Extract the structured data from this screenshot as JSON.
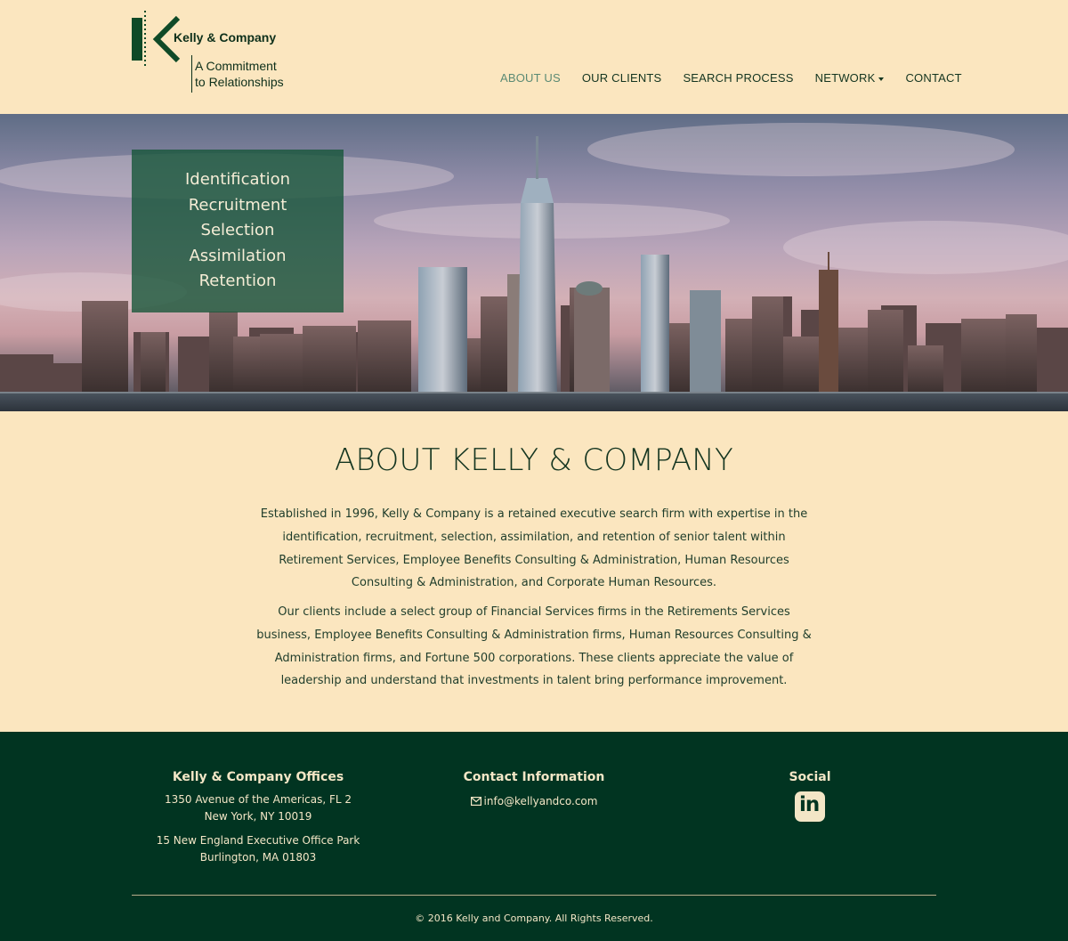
{
  "brand": {
    "name": "Kelly & Company",
    "tagline_line1": "A Commitment",
    "tagline_line2": "to Relationships",
    "color": "#0f4a27"
  },
  "nav": {
    "items": [
      {
        "label": "ABOUT US",
        "active": true
      },
      {
        "label": "OUR CLIENTS",
        "active": false
      },
      {
        "label": "SEARCH PROCESS",
        "active": false
      },
      {
        "label": "NETWORK",
        "active": false,
        "dropdown": true
      },
      {
        "label": "CONTACT",
        "active": false
      }
    ]
  },
  "hero": {
    "lines": [
      "Identification",
      "Recruitment",
      "Selection",
      "Assimilation",
      "Retention"
    ]
  },
  "about": {
    "title": "ABOUT KELLY & COMPANY",
    "paragraph1": "Established in 1996, Kelly & Company is a retained executive search firm with expertise in the identification, recruitment, selection, assimilation, and retention of senior talent within Retirement Services, Employee Benefits Consulting & Administration, Human Resources Consulting & Administration, and Corporate Human Resources.",
    "paragraph2": "Our clients include a select group of Financial Services firms in the Retirements Services business, Employee Benefits Consulting & Administration firms, Human Resources Consulting & Administration firms, and Fortune 500 corporations. These clients appreciate the value of leadership and understand that investments in talent bring performance improvement."
  },
  "footer": {
    "offices_heading": "Kelly & Company Offices",
    "office1_line1": "1350 Avenue of the Americas, FL 2",
    "office1_line2": "New York, NY 10019",
    "office2_line1": "15 New England Executive Office Park",
    "office2_line2": "Burlington, MA 01803",
    "contact_heading": "Contact Information",
    "email": "info@kellyandco.com",
    "social_heading": "Social",
    "social_icon": "linkedin-icon",
    "copyright": "© 2016 Kelly and Company. All Rights Reserved.",
    "background": "#013421"
  }
}
